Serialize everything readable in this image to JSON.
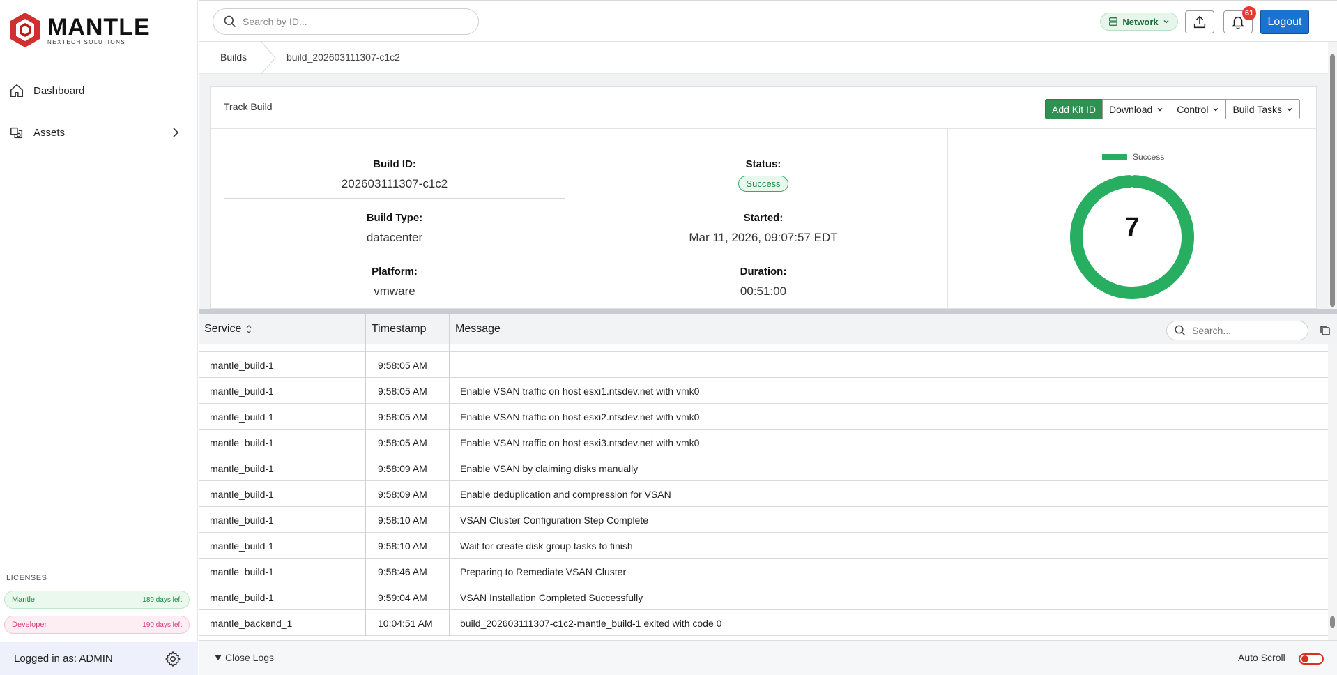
{
  "brand": {
    "name": "MANTLE",
    "tagline": "NEXTECH SOLUTIONS"
  },
  "sidebar": {
    "items": [
      {
        "label": "Dashboard",
        "icon": "home-icon"
      },
      {
        "label": "Assets",
        "icon": "assets-icon"
      }
    ],
    "licenses_label": "LICENSES",
    "licenses": [
      {
        "name": "Mantle",
        "days": "189 days left"
      },
      {
        "name": "Developer",
        "days": "190 days left"
      }
    ],
    "logged_in": "Logged in as: ADMIN"
  },
  "topbar": {
    "search_placeholder": "Search by ID...",
    "network_label": "Network",
    "notification_count": "61",
    "logout_label": "Logout"
  },
  "breadcrumb": {
    "root": "Builds",
    "current": "build_202603111307-c1c2"
  },
  "card": {
    "title": "Track Build",
    "buttons": {
      "add_kit": "Add Kit ID",
      "download": "Download",
      "control": "Control",
      "build_tasks": "Build Tasks"
    },
    "build_id_label": "Build ID:",
    "build_id": "202603111307-c1c2",
    "build_type_label": "Build Type:",
    "build_type": "datacenter",
    "platform_label": "Platform:",
    "platform": "vmware",
    "status_label": "Status:",
    "status": "Success",
    "started_label": "Started:",
    "started": "Mar 11, 2026, 09:07:57 EDT",
    "duration_label": "Duration:",
    "duration": "00:51:00"
  },
  "chart_data": {
    "type": "pie",
    "categories": [
      "Success"
    ],
    "values": [
      7
    ],
    "center_label": "7",
    "colors": [
      "#27ae60"
    ],
    "legend": "top"
  },
  "logs": {
    "columns": {
      "service": "Service",
      "timestamp": "Timestamp",
      "message": "Message"
    },
    "search_placeholder": "Search...",
    "rows": [
      {
        "service": "mantle_build-1",
        "time": "9:58:05 AM",
        "message": ""
      },
      {
        "service": "mantle_build-1",
        "time": "9:58:05 AM",
        "message": "Enable VSAN traffic on host esxi1.ntsdev.net with vmk0"
      },
      {
        "service": "mantle_build-1",
        "time": "9:58:05 AM",
        "message": "Enable VSAN traffic on host esxi2.ntsdev.net with vmk0"
      },
      {
        "service": "mantle_build-1",
        "time": "9:58:05 AM",
        "message": "Enable VSAN traffic on host esxi3.ntsdev.net with vmk0"
      },
      {
        "service": "mantle_build-1",
        "time": "9:58:09 AM",
        "message": "Enable VSAN by claiming disks manually"
      },
      {
        "service": "mantle_build-1",
        "time": "9:58:09 AM",
        "message": "Enable deduplication and compression for VSAN"
      },
      {
        "service": "mantle_build-1",
        "time": "9:58:10 AM",
        "message": "VSAN Cluster Configuration Step Complete"
      },
      {
        "service": "mantle_build-1",
        "time": "9:58:10 AM",
        "message": "Wait for create disk group tasks to finish"
      },
      {
        "service": "mantle_build-1",
        "time": "9:58:46 AM",
        "message": "Preparing to Remediate VSAN Cluster"
      },
      {
        "service": "mantle_build-1",
        "time": "9:59:04 AM",
        "message": "VSAN Installation Completed Successfully"
      },
      {
        "service": "mantle_backend_1",
        "time": "10:04:51 AM",
        "message": "build_202603111307-c1c2-mantle_build-1 exited with code 0"
      }
    ],
    "close_label": "Close Logs",
    "autoscroll_label": "Auto Scroll",
    "autoscroll_on": false
  },
  "colors": {
    "accent": "#1a73d1",
    "success": "#27ae60",
    "brand_red": "#d32f2f"
  }
}
